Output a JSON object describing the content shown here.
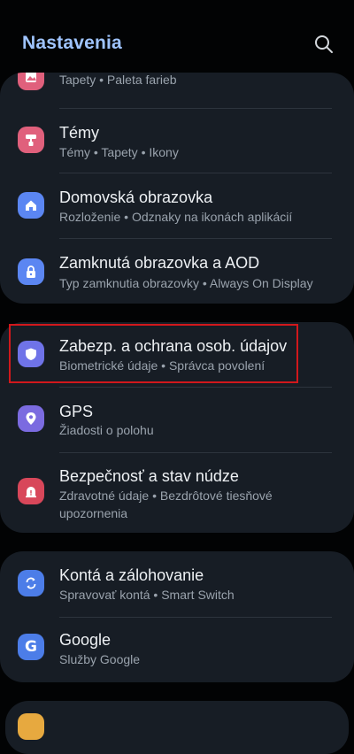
{
  "header": {
    "title": "Nastavenia",
    "search_icon": "search-icon"
  },
  "colors": {
    "background": "#020304",
    "card": "#171d25",
    "title": "#9fc4ff",
    "highlight": "#d1181c"
  },
  "card1": {
    "items": [
      {
        "subtitle": "Tapety • Paleta farieb",
        "icon": "wallpaper-icon",
        "icon_color": "#e0607c"
      },
      {
        "label": "Témy",
        "subtitle": "Témy • Tapety • Ikony",
        "icon": "themes-icon",
        "icon_color": "#e0607c"
      },
      {
        "label": "Domovská obrazovka",
        "subtitle": "Rozloženie • Odznaky na ikonách aplikácií",
        "icon": "home-icon",
        "icon_color": "#5b86f2"
      },
      {
        "label": "Zamknutá obrazovka a AOD",
        "subtitle": "Typ zamknutia obrazovky • Always On Display",
        "icon": "lock-icon",
        "icon_color": "#5b86f2"
      }
    ]
  },
  "card2": {
    "items": [
      {
        "label": "Zabezp. a ochrana osob. údajov",
        "subtitle": "Biometrické údaje • Správca povolení",
        "icon": "shield-icon",
        "icon_color": "#6f73e8"
      },
      {
        "label": "GPS",
        "subtitle": "Žiadosti o polohu",
        "icon": "location-icon",
        "icon_color": "#7b6be0"
      },
      {
        "label": "Bezpečnosť a stav núdze",
        "subtitle_line1": "Zdravotné údaje • Bezdrôtové tiesňové",
        "subtitle_line2": "upozornenia",
        "icon": "emergency-icon",
        "icon_color": "#d8475a"
      }
    ]
  },
  "card3": {
    "items": [
      {
        "label": "Kontá a zálohovanie",
        "subtitle": "Spravovať kontá • Smart Switch",
        "icon": "sync-icon",
        "icon_color": "#4c7de8"
      },
      {
        "label": "Google",
        "subtitle": "Služby Google",
        "icon": "google-icon",
        "icon_color": "#4c7de8"
      }
    ]
  }
}
